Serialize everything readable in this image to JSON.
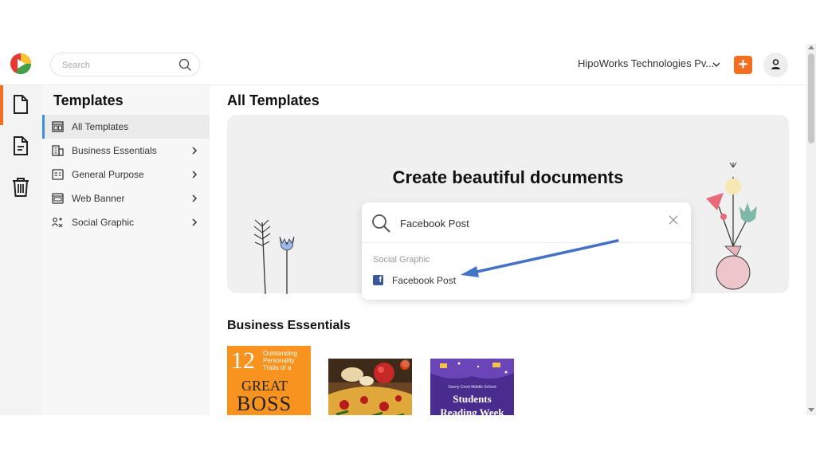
{
  "header": {
    "search_placeholder": "Search",
    "org_name": "HipoWorks Technologies Pv...",
    "add_label": "+"
  },
  "rail": {
    "items": [
      {
        "name": "documents",
        "icon": "document-icon",
        "active": true
      },
      {
        "name": "my-files",
        "icon": "file-text-icon",
        "active": false
      },
      {
        "name": "trash",
        "icon": "trash-icon",
        "active": false
      }
    ]
  },
  "sidebar": {
    "title": "Templates",
    "items": [
      {
        "label": "All Templates",
        "icon": "all-templates-icon",
        "active": true,
        "has_children": false
      },
      {
        "label": "Business Essentials",
        "icon": "building-icon",
        "active": false,
        "has_children": true
      },
      {
        "label": "General Purpose",
        "icon": "general-purpose-icon",
        "active": false,
        "has_children": true
      },
      {
        "label": "Web Banner",
        "icon": "web-banner-icon",
        "active": false,
        "has_children": true
      },
      {
        "label": "Social Graphic",
        "icon": "social-graphic-icon",
        "active": false,
        "has_children": true
      }
    ]
  },
  "main": {
    "title": "All Templates",
    "hero_title": "Create beautiful documents",
    "search": {
      "value": "Facebook Post",
      "group_label": "Social Graphic",
      "result_label": "Facebook Post",
      "result_icon": "facebook-icon"
    },
    "section_title": "Business Essentials",
    "thumbnails": {
      "t1": {
        "num": "12",
        "sub": "Outstanding Personality Traits of a",
        "big1": "GREAT",
        "big2": "BOSS"
      },
      "t2": {
        "kind": "pizza-photo"
      },
      "t3": {
        "school": "Sunny Crest Middle School",
        "line1": "Students",
        "line2": "Reading Week"
      }
    }
  },
  "colors": {
    "accent": "#f26f21",
    "active_blue": "#3b8de0",
    "facebook": "#3b5998",
    "annotation_arrow": "#4472c4"
  }
}
